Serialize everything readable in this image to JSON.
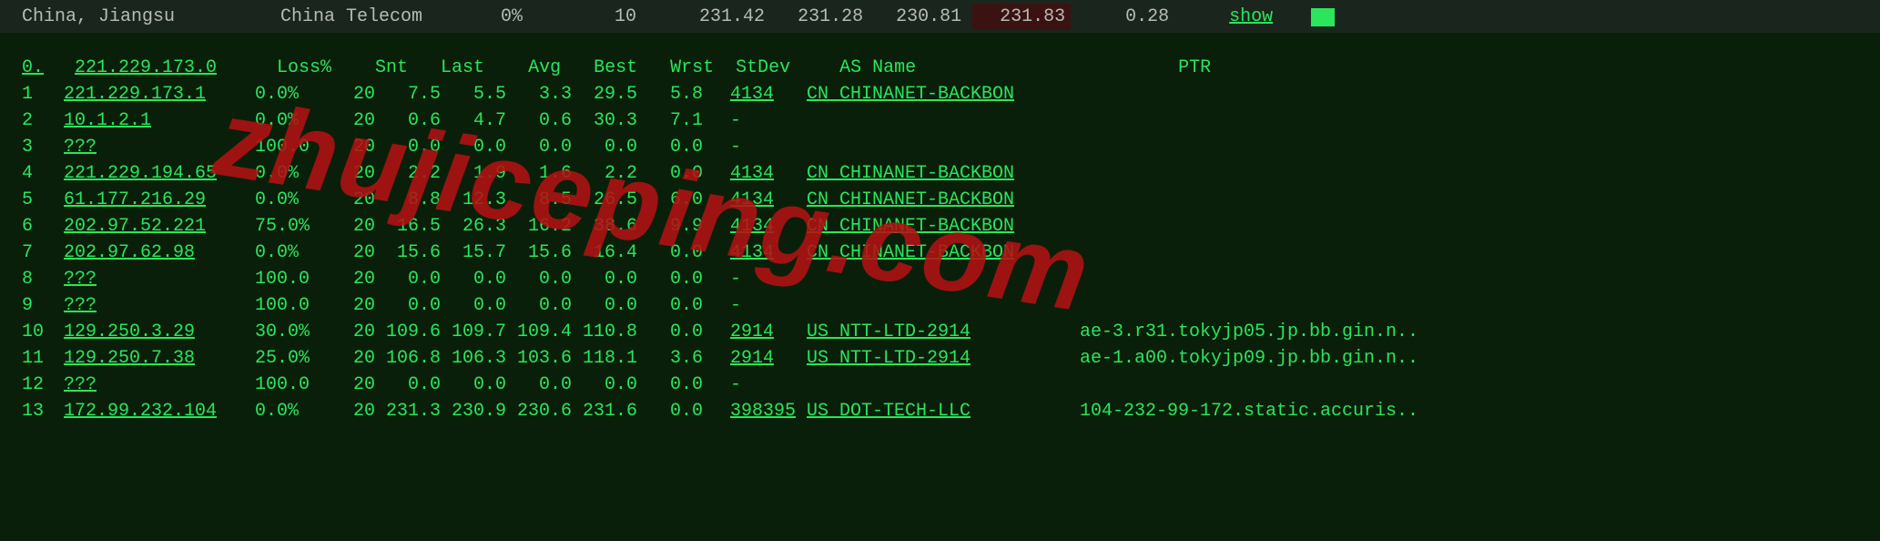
{
  "topbar": {
    "location": "China, Jiangsu",
    "isp": "China Telecom",
    "loss": "0%",
    "snt": "10",
    "last": "231.42",
    "avg": "231.28",
    "best": "230.81",
    "worst": "231.83",
    "stdev": "0.28",
    "show": "show"
  },
  "headers": {
    "hop": "0.",
    "host": "221.229.173.0",
    "loss": "Loss%",
    "snt": "Snt",
    "last": "Last",
    "avg": "Avg",
    "best": "Best",
    "wrst": "Wrst",
    "stdev": "StDev",
    "asname": "AS Name",
    "ptr": "PTR"
  },
  "rows": [
    {
      "hop": "1",
      "host": "221.229.173.1",
      "loss": "0.0%",
      "snt": "20",
      "last": "7.5",
      "avg": "5.5",
      "best": "3.3",
      "wrst": "29.5",
      "stdev": "5.8",
      "asn": "4134",
      "asname": "CN CHINANET-BACKBON",
      "ptr": ""
    },
    {
      "hop": "2",
      "host": "10.1.2.1",
      "loss": "0.0%",
      "snt": "20",
      "last": "0.6",
      "avg": "4.7",
      "best": "0.6",
      "wrst": "30.3",
      "stdev": "7.1",
      "asn": "-",
      "asname": "",
      "ptr": ""
    },
    {
      "hop": "3",
      "host": "???",
      "loss": "100.0",
      "snt": "20",
      "last": "0.0",
      "avg": "0.0",
      "best": "0.0",
      "wrst": "0.0",
      "stdev": "0.0",
      "asn": "-",
      "asname": "",
      "ptr": ""
    },
    {
      "hop": "4",
      "host": "221.229.194.65",
      "loss": "0.0%",
      "snt": "20",
      "last": "2.2",
      "avg": "1.9",
      "best": "1.6",
      "wrst": "2.2",
      "stdev": "0.0",
      "asn": "4134",
      "asname": "CN CHINANET-BACKBON",
      "ptr": ""
    },
    {
      "hop": "5",
      "host": "61.177.216.29",
      "loss": "0.0%",
      "snt": "20",
      "last": "8.8",
      "avg": "12.3",
      "best": "8.5",
      "wrst": "26.5",
      "stdev": "6.0",
      "asn": "4134",
      "asname": "CN CHINANET-BACKBON",
      "ptr": ""
    },
    {
      "hop": "6",
      "host": "202.97.52.221",
      "loss": "75.0%",
      "snt": "20",
      "last": "16.5",
      "avg": "26.3",
      "best": "16.2",
      "wrst": "38.6",
      "stdev": "9.9",
      "asn": "4134",
      "asname": "CN CHINANET-BACKBON",
      "ptr": ""
    },
    {
      "hop": "7",
      "host": "202.97.62.98",
      "loss": "0.0%",
      "snt": "20",
      "last": "15.6",
      "avg": "15.7",
      "best": "15.6",
      "wrst": "16.4",
      "stdev": "0.0",
      "asn": "4134",
      "asname": "CN CHINANET-BACKBON",
      "ptr": ""
    },
    {
      "hop": "8",
      "host": "???",
      "loss": "100.0",
      "snt": "20",
      "last": "0.0",
      "avg": "0.0",
      "best": "0.0",
      "wrst": "0.0",
      "stdev": "0.0",
      "asn": "-",
      "asname": "",
      "ptr": ""
    },
    {
      "hop": "9",
      "host": "???",
      "loss": "100.0",
      "snt": "20",
      "last": "0.0",
      "avg": "0.0",
      "best": "0.0",
      "wrst": "0.0",
      "stdev": "0.0",
      "asn": "-",
      "asname": "",
      "ptr": ""
    },
    {
      "hop": "10",
      "host": "129.250.3.29",
      "loss": "30.0%",
      "snt": "20",
      "last": "109.6",
      "avg": "109.7",
      "best": "109.4",
      "wrst": "110.8",
      "stdev": "0.0",
      "asn": "2914",
      "asname": "US NTT-LTD-2914",
      "ptr": "ae-3.r31.tokyjp05.jp.bb.gin.n.."
    },
    {
      "hop": "11",
      "host": "129.250.7.38",
      "loss": "25.0%",
      "snt": "20",
      "last": "106.8",
      "avg": "106.3",
      "best": "103.6",
      "wrst": "118.1",
      "stdev": "3.6",
      "asn": "2914",
      "asname": "US NTT-LTD-2914",
      "ptr": "ae-1.a00.tokyjp09.jp.bb.gin.n.."
    },
    {
      "hop": "12",
      "host": "???",
      "loss": "100.0",
      "snt": "20",
      "last": "0.0",
      "avg": "0.0",
      "best": "0.0",
      "wrst": "0.0",
      "stdev": "0.0",
      "asn": "-",
      "asname": "",
      "ptr": ""
    },
    {
      "hop": "13",
      "host": "172.99.232.104",
      "loss": "0.0%",
      "snt": "20",
      "last": "231.3",
      "avg": "230.9",
      "best": "230.6",
      "wrst": "231.6",
      "stdev": "0.0",
      "asn": "398395",
      "asname": "US DOT-TECH-LLC",
      "ptr": "104-232-99-172.static.accuris.."
    }
  ],
  "watermark": "zhujiceping.com"
}
